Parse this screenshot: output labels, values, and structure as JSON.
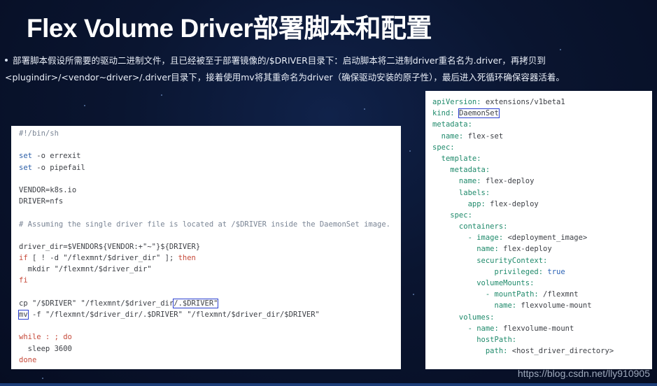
{
  "slide": {
    "title": "Flex Volume Driver部署脚本和配置",
    "description_line1": "部署脚本假设所需要的驱动二进制文件，且已经被至于部署镜像的/$DRIVER目录下：启动脚本将二进制driver重名名为.driver，再拷贝到",
    "description_line2": "<plugindir>/<vendor~driver>/.driver目录下，接着使用mv将其重命名为driver（确保驱动安装的原子性），最后进入死循环确保容器活着。",
    "watermark": "https://blog.csdn.net/lly910905"
  },
  "script": {
    "shebang": "#!/bin/sh",
    "set1_kw": "set",
    "set1_rest": " -o errexit",
    "set2_kw": "set",
    "set2_rest": " -o pipefail",
    "vendor": "VENDOR=k8s.io",
    "driver": "DRIVER=nfs",
    "comment": "# Assuming the single driver file is located at /$DRIVER inside the DaemonSet image.",
    "driver_dir": "driver_dir=$VENDOR${VENDOR:+\"~\"}${DRIVER}",
    "if_kw": "if",
    "if_rest": " [ ! -d \"/flexmnt/$driver_dir\" ]; ",
    "then_kw": "then",
    "mkdir": "  mkdir \"/flexmnt/$driver_dir\"",
    "fi_kw": "fi",
    "cp_a": "cp \"/$DRIVER\" \"/flexmnt/$driver_dir",
    "cp_boxed": "/.$DRIVER\"",
    "mv_boxed": "mv",
    "mv_rest": " -f \"/flexmnt/$driver_dir/.$DRIVER\" \"/flexmnt/$driver_dir/$DRIVER\"",
    "while_kw": "while : ; do",
    "sleep": "  sleep 3600",
    "done_kw": "done"
  },
  "yaml": {
    "l1k": "apiVersion:",
    "l1v": " extensions/v1beta1",
    "l2k": "kind:",
    "l2v": "DaemonSet",
    "l3k": "metadata:",
    "l4k": "  name:",
    "l4v": " flex-set",
    "l5k": "spec:",
    "l6k": "  template:",
    "l7k": "    metadata:",
    "l8k": "      name:",
    "l8v": " flex-deploy",
    "l9k": "      labels:",
    "l10k": "        app:",
    "l10v": " flex-deploy",
    "l11k": "    spec:",
    "l12k": "      containers:",
    "l13k": "        - image:",
    "l13v": " <deployment_image>",
    "l14k": "          name:",
    "l14v": " flex-deploy",
    "l15k": "          securityContext:",
    "l16k": "              privileged:",
    "l16v": " true",
    "l17k": "          volumeMounts:",
    "l18k": "            - mountPath:",
    "l18v": " /flexmnt",
    "l19k": "              name:",
    "l19v": " flexvolume-mount",
    "l20k": "      volumes:",
    "l21k": "        - name:",
    "l21v": " flexvolume-mount",
    "l22k": "          hostPath:",
    "l23k": "            path:",
    "l23v": " <host_driver_directory>"
  }
}
